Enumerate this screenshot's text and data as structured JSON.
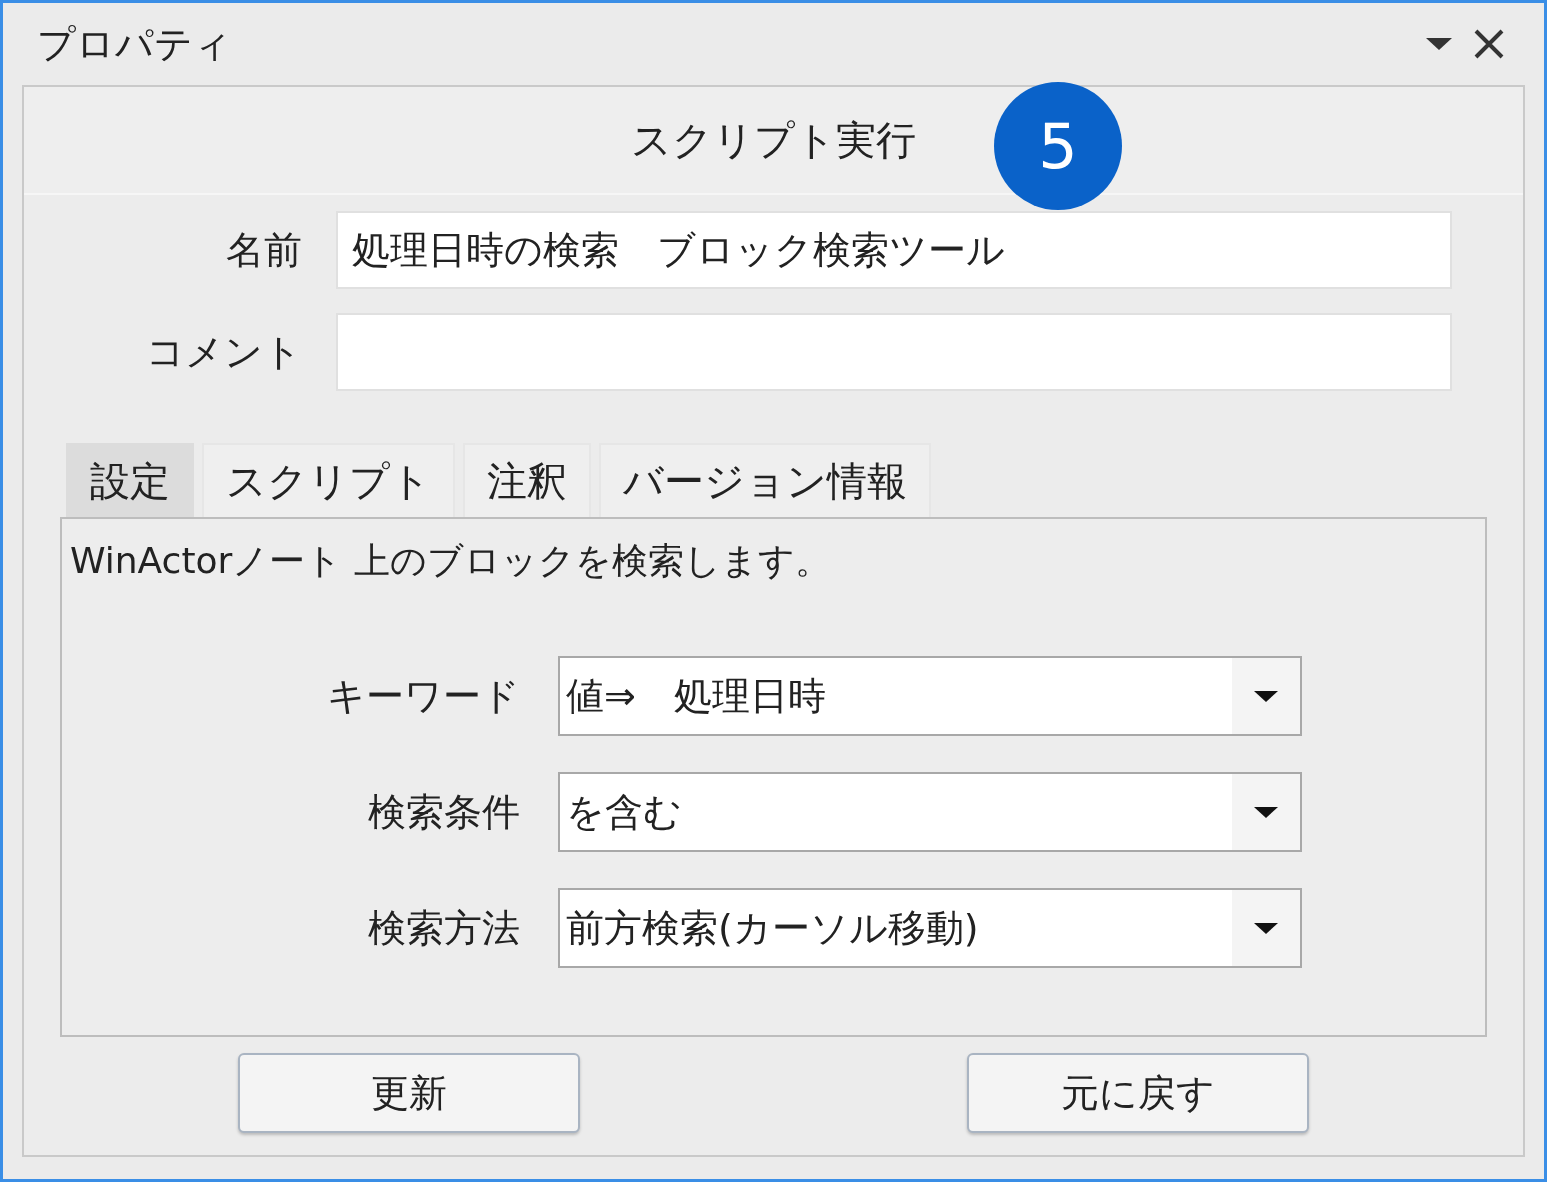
{
  "window": {
    "title": "プロパティ"
  },
  "header": {
    "title": "スクリプト実行",
    "badge": "5"
  },
  "fields": [
    {
      "label": "名前",
      "value": "処理日時の検索　ブロック検索ツール"
    },
    {
      "label": "コメント"
    }
  ],
  "tabs": [
    {
      "label": "設定",
      "selected": true
    },
    {
      "label": "スクリプト",
      "selected": false
    },
    {
      "label": "注釈",
      "selected": false
    },
    {
      "label": "バージョン情報",
      "selected": false
    }
  ],
  "description": "WinActorノート 上のブロックを検索します。",
  "settings": [
    {
      "label": "キーワード",
      "value": "値⇒　処理日時"
    },
    {
      "label": "検索条件",
      "value": "を含む"
    },
    {
      "label": "検索方法",
      "value": "前方検索(カーソル移動)"
    }
  ],
  "buttons": [
    "更新",
    "元に戻す"
  ]
}
